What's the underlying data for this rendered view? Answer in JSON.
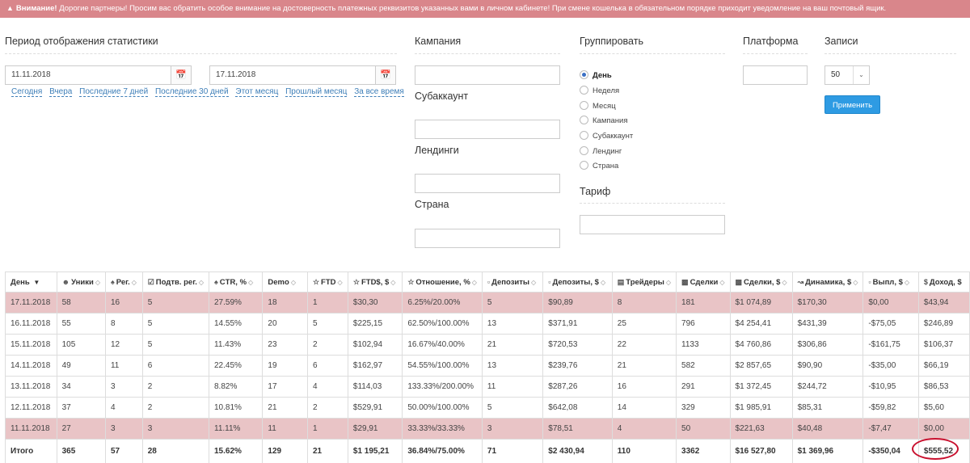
{
  "alert": {
    "title": "Внимание!",
    "text": "Дорогие партнеры! Просим вас обратить особое внимание на достоверность платежных реквизитов указанных вами в личном кабинете! При смене кошелька в обязательном порядке приходит уведомление на ваш почтовый ящик."
  },
  "period": {
    "title": "Период отображения статистики",
    "date_from": "11.11.2018",
    "date_to": "17.11.2018",
    "quick": [
      "Сегодня",
      "Вчера",
      "Последние 7 дней",
      "Последние 30 дней",
      "Этот месяц",
      "Прошлый месяц",
      "За все время"
    ]
  },
  "filters": {
    "campaign": "Кампания",
    "subaccount": "Субаккаунт",
    "landings": "Лендинги",
    "country": "Страна",
    "group_title": "Группировать",
    "group_options": [
      "День",
      "Неделя",
      "Месяц",
      "Кампания",
      "Субаккаунт",
      "Лендинг",
      "Страна"
    ],
    "group_selected": "День",
    "tariff": "Тариф",
    "platform": "Платформа",
    "records": "Записи",
    "records_value": "50",
    "apply": "Применить"
  },
  "table": {
    "headers": [
      "День",
      "Уники",
      "Рег.",
      "Подтв. рег.",
      "CTR, %",
      "Demo",
      "FTD",
      "FTD$, $",
      "Отношение, %",
      "Депозиты",
      "Депозиты, $",
      "Трейдеры",
      "Сделки",
      "Сделки, $",
      "Динамика, $",
      "Выпл, $",
      "Доход, $"
    ],
    "rows": [
      [
        "17.11.2018",
        "58",
        "16",
        "5",
        "27.59%",
        "18",
        "1",
        "$30,30",
        "6.25%/20.00%",
        "5",
        "$90,89",
        "8",
        "181",
        "$1 074,89",
        "$170,30",
        "$0,00",
        "$43,94"
      ],
      [
        "16.11.2018",
        "55",
        "8",
        "5",
        "14.55%",
        "20",
        "5",
        "$225,15",
        "62.50%/100.00%",
        "13",
        "$371,91",
        "25",
        "796",
        "$4 254,41",
        "$431,39",
        "-$75,05",
        "$246,89"
      ],
      [
        "15.11.2018",
        "105",
        "12",
        "5",
        "11.43%",
        "23",
        "2",
        "$102,94",
        "16.67%/40.00%",
        "21",
        "$720,53",
        "22",
        "1133",
        "$4 760,86",
        "$306,86",
        "-$161,75",
        "$106,37"
      ],
      [
        "14.11.2018",
        "49",
        "11",
        "6",
        "22.45%",
        "19",
        "6",
        "$162,97",
        "54.55%/100.00%",
        "13",
        "$239,76",
        "21",
        "582",
        "$2 857,65",
        "$90,90",
        "-$35,00",
        "$66,19"
      ],
      [
        "13.11.2018",
        "34",
        "3",
        "2",
        "8.82%",
        "17",
        "4",
        "$114,03",
        "133.33%/200.00%",
        "11",
        "$287,26",
        "16",
        "291",
        "$1 372,45",
        "$244,72",
        "-$10,95",
        "$86,53"
      ],
      [
        "12.11.2018",
        "37",
        "4",
        "2",
        "10.81%",
        "21",
        "2",
        "$529,91",
        "50.00%/100.00%",
        "5",
        "$642,08",
        "14",
        "329",
        "$1 985,91",
        "$85,31",
        "-$59,82",
        "$5,60"
      ],
      [
        "11.11.2018",
        "27",
        "3",
        "3",
        "11.11%",
        "11",
        "1",
        "$29,91",
        "33.33%/33.33%",
        "3",
        "$78,51",
        "4",
        "50",
        "$221,63",
        "$40,48",
        "-$7,47",
        "$0,00"
      ]
    ],
    "total": [
      "Итого",
      "365",
      "57",
      "28",
      "15.62%",
      "129",
      "21",
      "$1 195,21",
      "36.84%/75.00%",
      "71",
      "$2 430,94",
      "110",
      "3362",
      "$16 527,80",
      "$1 369,96",
      "-$350,04",
      "$555,52"
    ]
  }
}
